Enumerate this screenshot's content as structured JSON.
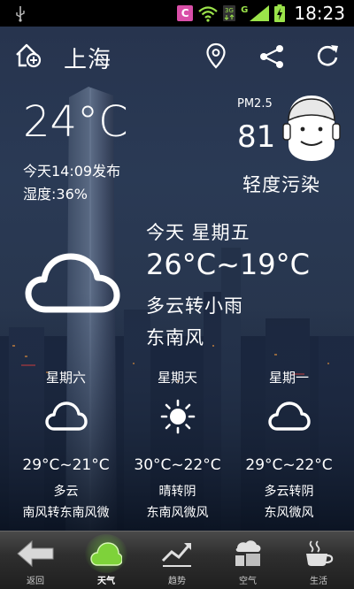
{
  "status_bar": {
    "app_badge": "C",
    "network_3g": "3G",
    "network_g": "G",
    "time": "18:23"
  },
  "header": {
    "city": "上海",
    "icons": [
      "add-city-icon",
      "location-icon",
      "share-icon",
      "refresh-icon"
    ]
  },
  "current": {
    "temperature": "24°C",
    "published": "今天14:09发布",
    "humidity": "湿度:36%",
    "icon": "cloudy-icon"
  },
  "air": {
    "label": "PM2.5",
    "value": "81",
    "status": "轻度污染"
  },
  "today": {
    "day": "今天 星期五",
    "range": "26°C~19°C",
    "condition": "多云转小雨",
    "wind": "东南风"
  },
  "forecast": [
    {
      "day": "星期六",
      "icon": "cloudy-icon",
      "range": "29°C~21°C",
      "condition": "多云",
      "wind": "南风转东南风微"
    },
    {
      "day": "星期天",
      "icon": "sunny-icon",
      "range": "30°C~22°C",
      "condition": "晴转阴",
      "wind": "东南风微风"
    },
    {
      "day": "星期一",
      "icon": "cloudy-icon",
      "range": "29°C~22°C",
      "condition": "多云转阴",
      "wind": "东风微风"
    }
  ],
  "nav": [
    {
      "label": "返回",
      "icon": "back-arrow-icon"
    },
    {
      "label": "天气",
      "icon": "weather-icon",
      "active": true
    },
    {
      "label": "趋势",
      "icon": "trend-icon"
    },
    {
      "label": "空气",
      "icon": "air-icon"
    },
    {
      "label": "生活",
      "icon": "coffee-cup-icon"
    }
  ],
  "colors": {
    "status_bar": "#000000",
    "nav_active_glow": "#78dc3c",
    "signal_green": "#9be34a"
  }
}
